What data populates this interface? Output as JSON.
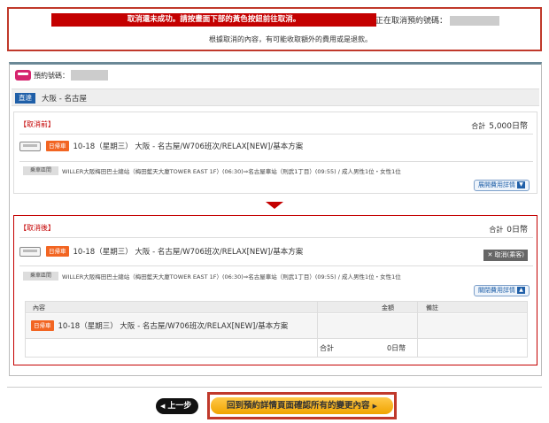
{
  "alert": {
    "message": "取消還未成功。請按畫面下部的黃色按鈕前往取消。",
    "cancelling_label": "正在取消預約號碼：",
    "sub_message": "根據取消的內容，有可能收取額外的費用或是退款。"
  },
  "reservation": {
    "label": "預約號碼：",
    "direct_badge": "直達",
    "route": "大阪 - 名古屋"
  },
  "before": {
    "title": "【取消前】",
    "total_label": "合計",
    "total_value": "5,000日幣",
    "day_badge": "日帰車",
    "trip": "10-18（星期三） 大阪 - 名古屋/W706班次/RELAX[NEW]/基本方案",
    "seat_badge": "乗車區間",
    "detail": "WILLER大阪梅田巴士總站（梅田藍天大廈TOWER EAST 1F）(06:30)⇒名古屋車站（則武1丁目）(09:55) / 成人男性1位・女性1位",
    "detail_button": "展開費用詳情"
  },
  "after": {
    "title": "【取消後】",
    "total_label": "合計",
    "total_value": "0日幣",
    "day_badge": "日帰車",
    "trip": "10-18（星期三） 大阪 - 名古屋/W706班次/RELAX[NEW]/基本方案",
    "cancel_tag": "✕ 取消(乘客)",
    "seat_badge": "乗車區間",
    "detail": "WILLER大阪梅田巴士總站（梅田藍天大廈TOWER EAST 1F）(06:30)⇒名古屋車站（則武1丁目）(09:55) / 成人男性1位・女性1位",
    "detail_button": "關閉費用詳情",
    "table": {
      "col_content": "內容",
      "col_amount": "金額",
      "col_note": "備註",
      "row_trip": "10-18（星期三） 大阪 - 名古屋/W706班次/RELAX[NEW]/基本方案",
      "total_label": "合計",
      "total_value": "0日幣"
    }
  },
  "buttons": {
    "back": "上一步",
    "confirm": "回到預約詳情頁面確認所有的變更內容"
  },
  "colors": {
    "alert_red": "#c40000",
    "header_bar": "#6a8896",
    "badge_blue": "#1f5fa8",
    "day_badge_orange": "#f26522",
    "confirm_yellow": "#f0a400"
  }
}
